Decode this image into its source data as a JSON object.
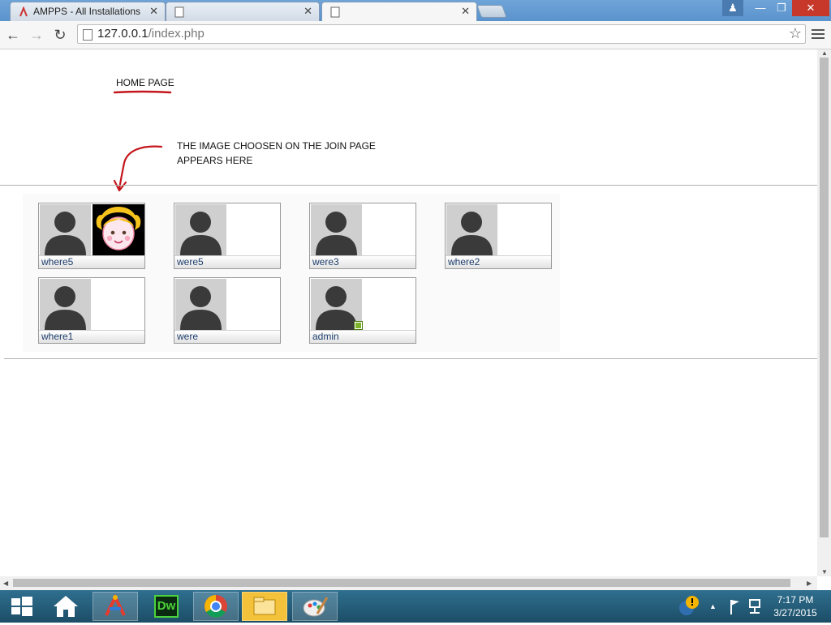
{
  "browser": {
    "tabs": [
      {
        "title": "AMPPS - All Installations"
      },
      {
        "title": ""
      },
      {
        "title": ""
      }
    ],
    "url_host": "127.0.0.1",
    "url_path": "/index.php"
  },
  "page": {
    "home_title": "HOME PAGE",
    "annotation_line1": "THE IMAGE CHOOSEN ON THE JOIN PAGE",
    "annotation_line2": "APPEARS HERE",
    "users": [
      {
        "name": "where5",
        "has_image": true
      },
      {
        "name": "were5"
      },
      {
        "name": "were3"
      },
      {
        "name": "where2"
      },
      {
        "name": "where1"
      },
      {
        "name": "were"
      },
      {
        "name": "admin",
        "online": true
      }
    ]
  },
  "taskbar": {
    "dw_label": "Dw",
    "time": "7:17 PM",
    "date": "3/27/2015"
  },
  "colors": {
    "annotation": "#c4161c",
    "online": "#7bb428",
    "titlebar": "#5b93cc"
  }
}
